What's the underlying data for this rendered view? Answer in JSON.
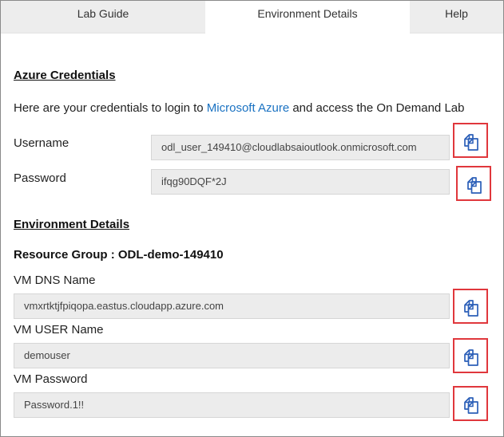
{
  "tabs": [
    {
      "label": "Lab Guide"
    },
    {
      "label": "Environment Details"
    },
    {
      "label": "Help"
    }
  ],
  "azure": {
    "title": "Azure Credentials",
    "intro_before": "Here are your credentials to login to ",
    "intro_link": "Microsoft Azure",
    "intro_after": " and access the On Demand Lab",
    "username_label": "Username",
    "username_value": "odl_user_149410@cloudlabsaioutlook.onmicrosoft.com",
    "password_label": "Password",
    "password_value": "ifqg90DQF*2J"
  },
  "env": {
    "title": "Environment Details",
    "resource_group": "Resource Group : ODL-demo-149410",
    "vm_dns_label": "VM DNS Name",
    "vm_dns_value": "vmxrtktjfpiqopa.eastus.cloudapp.azure.com",
    "vm_user_label": "VM USER Name",
    "vm_user_value": "demouser",
    "vm_password_label": "VM Password",
    "vm_password_value": "Password.1!!"
  },
  "icons": {
    "copy": "copy-icon"
  },
  "colors": {
    "link": "#1a72c2",
    "highlight_border": "#e0373c",
    "icon": "#2b5fb8"
  }
}
